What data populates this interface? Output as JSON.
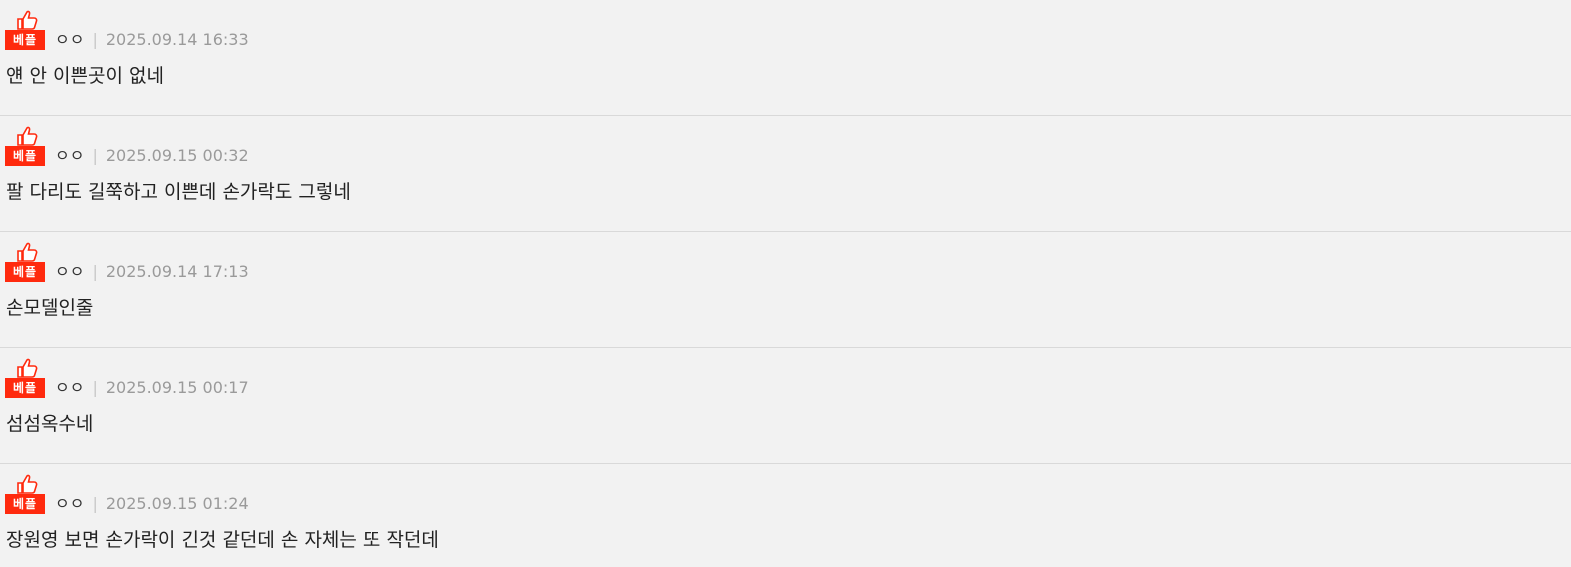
{
  "comments": [
    {
      "badge": "베플",
      "author": "ㅇㅇ",
      "separator": "|",
      "timestamp": "2025.09.14 16:33",
      "text": "얜 안 이쁜곳이 없네"
    },
    {
      "badge": "베플",
      "author": "ㅇㅇ",
      "separator": "|",
      "timestamp": "2025.09.15 00:32",
      "text": "팔 다리도 길쭉하고 이쁜데 손가락도 그렇네"
    },
    {
      "badge": "베플",
      "author": "ㅇㅇ",
      "separator": "|",
      "timestamp": "2025.09.14 17:13",
      "text": "손모델인줄"
    },
    {
      "badge": "베플",
      "author": "ㅇㅇ",
      "separator": "|",
      "timestamp": "2025.09.15 00:17",
      "text": "섬섬옥수네"
    },
    {
      "badge": "베플",
      "author": "ㅇㅇ",
      "separator": "|",
      "timestamp": "2025.09.15 01:24",
      "text": "장원영 보면 손가락이 긴것 같던데 손 자체는 또 작던데"
    }
  ],
  "colors": {
    "badge_bg": "#ff2a0e",
    "thumb_icon": "#ff2a0e",
    "background": "#f2f2f2",
    "timestamp": "#9a9a9a"
  },
  "icons": {
    "thumb": "thumbs-up-icon"
  }
}
